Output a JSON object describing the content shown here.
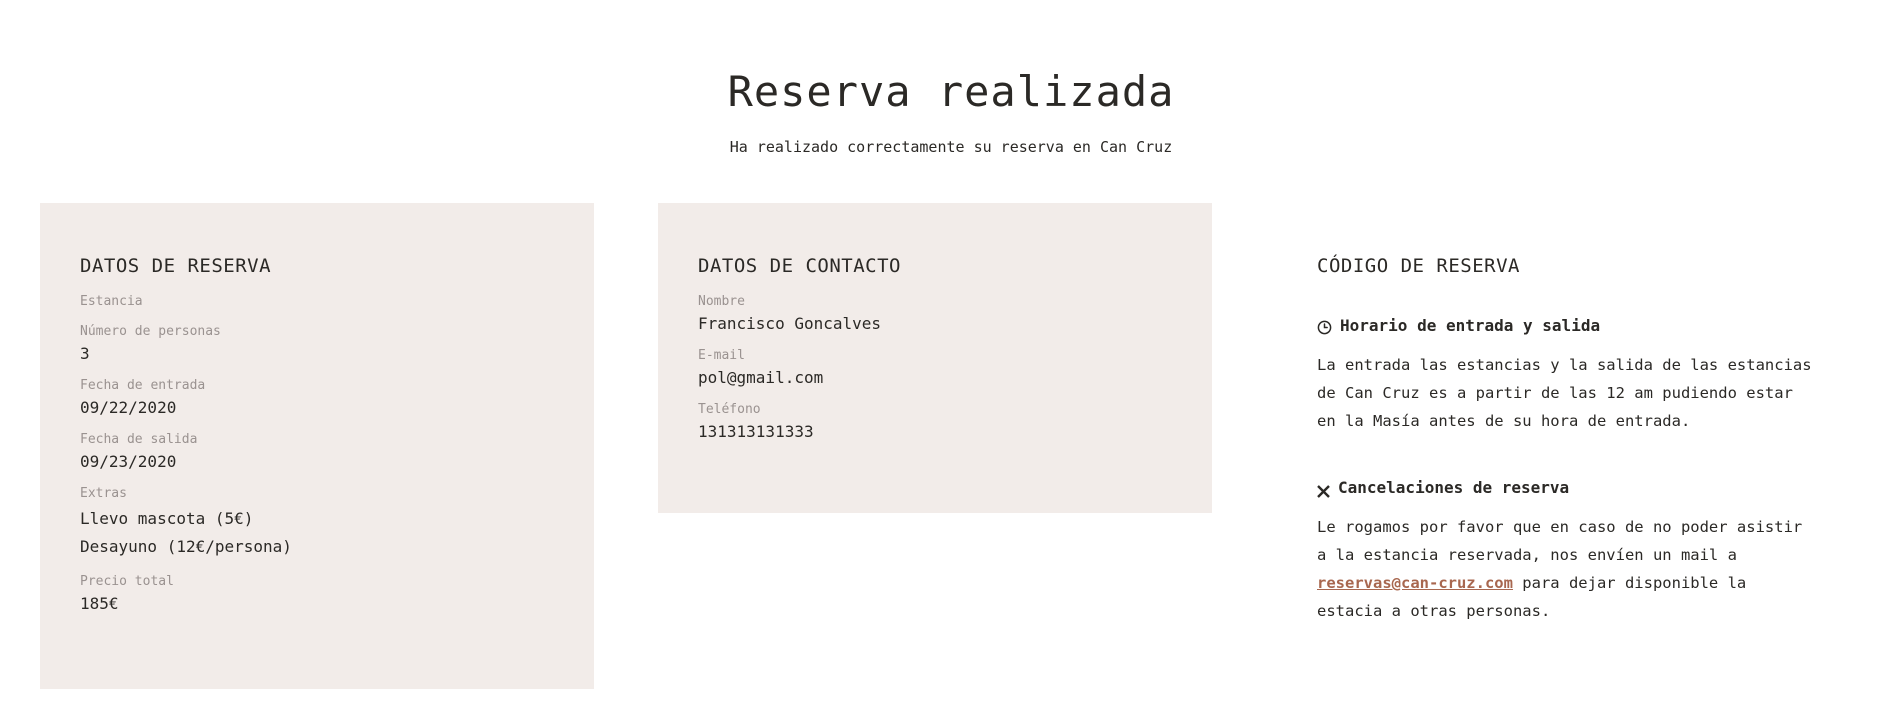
{
  "header": {
    "title": "Reserva realizada",
    "subtitle": "Ha realizado correctamente su reserva en Can Cruz"
  },
  "reserva": {
    "title": "DATOS DE RESERVA",
    "estancia_label": "Estancia",
    "personas_label": "Número de personas",
    "personas_value": "3",
    "entrada_label": "Fecha de entrada",
    "entrada_value": "09/22/2020",
    "salida_label": "Fecha de salida",
    "salida_value": "09/23/2020",
    "extras_label": "Extras",
    "extras": [
      "Llevo mascota (5€)",
      "Desayuno (12€/persona)"
    ],
    "precio_label": "Precio total",
    "precio_value": "185€"
  },
  "contacto": {
    "title": "DATOS DE CONTACTO",
    "nombre_label": "Nombre",
    "nombre_value": "Francisco Goncalves",
    "email_label": "E-mail",
    "email_value": "pol@gmail.com",
    "telefono_label": "Teléfono",
    "telefono_value": "131313131333"
  },
  "codigo": {
    "title": "CÓDIGO DE RESERVA",
    "horario_icon": "clock-icon",
    "horario_title": "Horario de entrada y salida",
    "horario_text": "La entrada las estancias y la salida de las estancias de Can Cruz es a partir de las 12 am pudiendo estar en la Masía antes de su hora de entrada.",
    "cancel_icon": "close-icon",
    "cancel_title": "Cancelaciones de reserva",
    "cancel_text_before": "Le rogamos por favor que en caso de no poder asistir a la estancia reservada, nos envíen un mail a ",
    "cancel_email": "reservas@can-cruz.com",
    "cancel_text_after": " para dejar disponible la estacia a otras personas."
  },
  "colors": {
    "card_bg": "#f2ece9",
    "text": "#2b2926",
    "muted": "#9a9290",
    "link": "#a8674f"
  }
}
